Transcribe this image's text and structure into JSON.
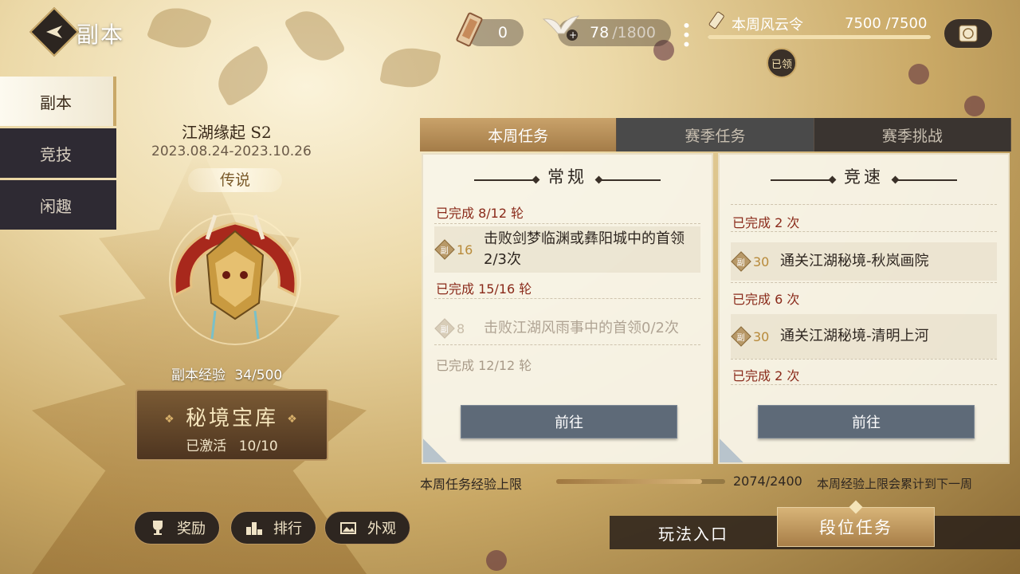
{
  "header": {
    "title": "副本"
  },
  "side_tabs": [
    {
      "label": "副本",
      "active": true
    },
    {
      "label": "竞技",
      "active": false
    },
    {
      "label": "闲趣",
      "active": false
    }
  ],
  "resources": {
    "token_count": "0",
    "stamina": "78",
    "stamina_max": "/1800",
    "weekly_title": "本周风云令",
    "weekly_value": "7500 /7500",
    "weekly_progress": 1.0,
    "claimed_badge": "已领"
  },
  "season": {
    "title": "江湖缘起 S2",
    "dates": "2023.08.24-2023.10.26",
    "rank": "传说",
    "exp_label": "副本经验",
    "exp_value": "34/500"
  },
  "treasure": {
    "title": "秘境宝库",
    "status": "已激活",
    "count": "10/10"
  },
  "left_buttons": {
    "reward": "奖励",
    "ranking": "排行",
    "appearance": "外观"
  },
  "tabs": [
    {
      "label": "本周任务",
      "active": true
    },
    {
      "label": "赛季任务",
      "active": false
    },
    {
      "label": "赛季挑战",
      "active": false
    }
  ],
  "regular": {
    "title": "常规",
    "done_1": "已完成 8/12 轮",
    "task_1_reward": "16",
    "task_1_text": "击败剑梦临渊或彝阳城中的首领2/3次",
    "done_2": "已完成 15/16 轮",
    "task_2_reward": "8",
    "task_2_text": "击败江湖风雨事中的首领0/2次",
    "done_3": "已完成 12/12 轮",
    "go": "前往"
  },
  "speed": {
    "title": "竞速",
    "done_1": "已完成 2 次",
    "task_1_reward": "30",
    "task_1_text": "通关江湖秘境-秋岚画院",
    "done_2": "已完成 6 次",
    "task_2_reward": "30",
    "task_2_text": "通关江湖秘境-清明上河",
    "done_3": "已完成 2 次",
    "go": "前往"
  },
  "weekly_exp": {
    "label": "本周任务经验上限",
    "value": "2074/2400",
    "progress": 0.864,
    "note": "本周经验上限会累计到下一周"
  },
  "bottom": {
    "entry": "玩法入口",
    "rank_task": "段位任务"
  },
  "colors": {
    "accent_gold": "#c9a868",
    "done_red": "#8a2a1a",
    "go_button": "#5e6a78"
  }
}
